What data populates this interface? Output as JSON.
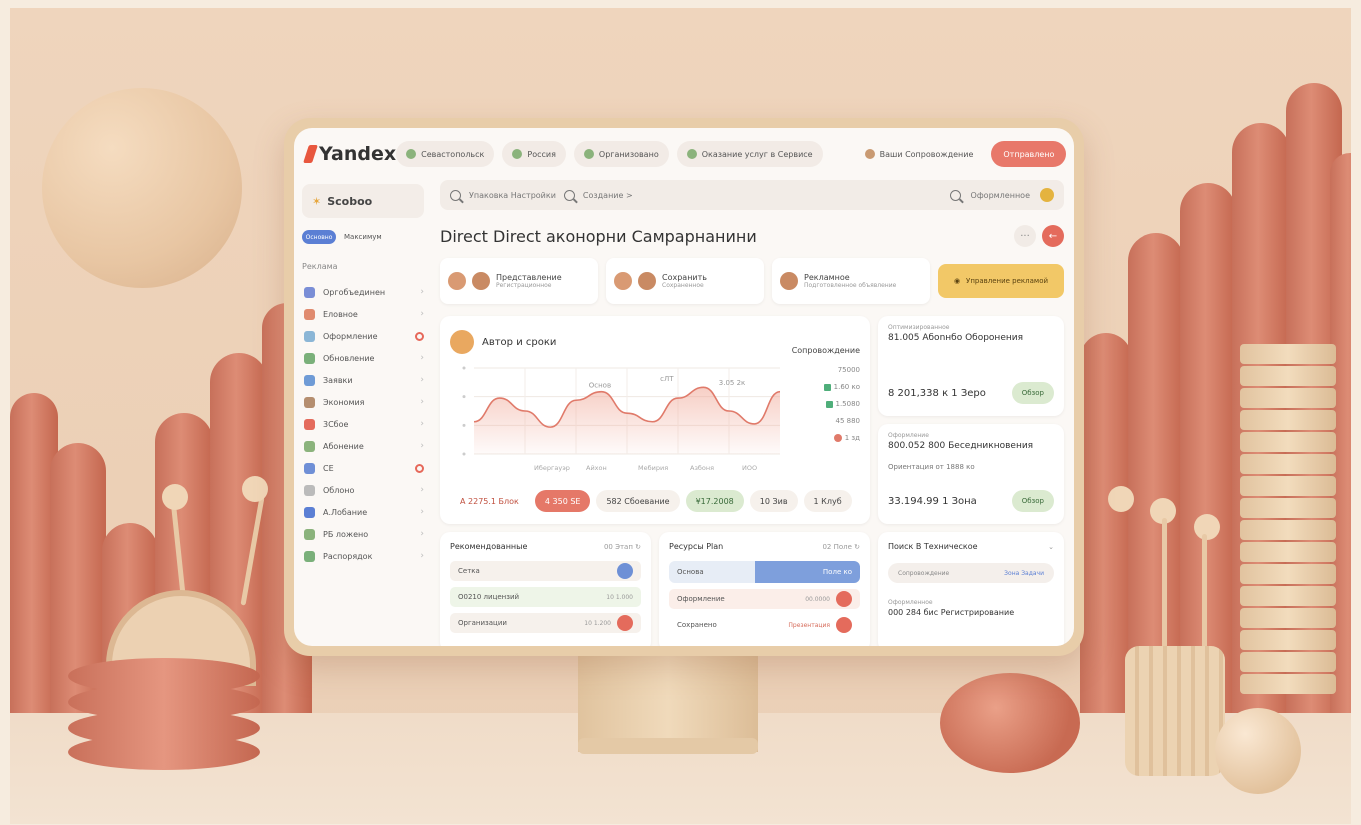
{
  "brand": {
    "name": "Yandex"
  },
  "nav": {
    "pills": [
      "Севастопольск",
      "Россия",
      "Организовано",
      "Оказание услуг в Сервисе"
    ],
    "secondary": "Ваши Сопровождение",
    "cta": "Отправлено"
  },
  "sidebar": {
    "head": "Scoboo",
    "toggle_label": "Основно",
    "toggle_text": "Максимум",
    "section": "Реклама",
    "items": [
      {
        "label": "Оргобъединен",
        "icon_color": "#7a8ed6"
      },
      {
        "label": "Еловное",
        "icon_color": "#e08b6f"
      },
      {
        "label": "Оформление",
        "icon_color": "#8bb6d6"
      },
      {
        "label": "Обновление",
        "icon_color": "#7ab07a"
      },
      {
        "label": "Заявки",
        "icon_color": "#6f9bd6"
      },
      {
        "label": "Экономия",
        "icon_color": "#b58e6f"
      },
      {
        "label": "3Сбое",
        "icon_color": "#e46b5c"
      },
      {
        "label": "Абонение",
        "icon_color": "#8bb37c"
      },
      {
        "label": "СЕ",
        "icon_color": "#6f8fd6"
      },
      {
        "label": "Облоно",
        "icon_color": "#bbbbbb"
      },
      {
        "label": "А.Лобание",
        "icon_color": "#5b7fd4"
      },
      {
        "label": "РБ ложено",
        "icon_color": "#8bb37c"
      },
      {
        "label": "Распорядок",
        "icon_color": "#7ab07a"
      }
    ]
  },
  "search": {
    "left": "Упаковка Настройки",
    "crumb": "Создание >",
    "right": "Оформленное"
  },
  "page": {
    "title": "Direct Direct аконоpни Самрарнанини"
  },
  "mini_cards": [
    {
      "title": "Представление",
      "sub": "Регистрационное"
    },
    {
      "title": "Сохранить",
      "sub": "Сохраненное"
    },
    {
      "title": "Рекламное",
      "sub": "Подготовленное объявление"
    }
  ],
  "mini_cta": "Управление рекламой",
  "chart_card": {
    "title": "Автор и сроки",
    "right_label": "Сопровождение",
    "legend": [
      "75000",
      "1.60 ко",
      "1.5080",
      "45 880",
      "1 зд"
    ],
    "annotations": [
      "Основ",
      "сЛТ",
      "3.05 2к"
    ],
    "xlabels": [
      "Ибергауэр",
      "Айхон",
      "Мебирия",
      "Азбоня",
      "ИОО"
    ],
    "chips": [
      "А 2275.1 Блок",
      "4 350 SE",
      "582 Сбоевание",
      "¥17.2008",
      "10 Зив",
      "1 Клуб"
    ]
  },
  "chart_data": {
    "type": "area",
    "x": [
      0,
      1,
      2,
      3,
      4,
      5,
      6,
      7,
      8,
      9,
      10,
      11,
      12
    ],
    "values": [
      30,
      52,
      40,
      25,
      50,
      58,
      38,
      30,
      52,
      62,
      40,
      28,
      58
    ],
    "grid": true
  },
  "stats": [
    {
      "small": "Оптимизированное",
      "bold": "81.005 Абоnнбо Оборонения",
      "big": "8 201,338 к 1 Зеро",
      "pill": "Обзор"
    },
    {
      "small": "Оформление",
      "bold": "800.052 800 Беседникновения",
      "sub": "Ориентация от 1888 ко",
      "big": "33.194.99 1 Зона",
      "pill": "Обзор"
    }
  ],
  "bottom": {
    "card1": {
      "title": "Рекомендованные",
      "right": "00 Этап ↻",
      "rows": [
        {
          "label": "Сетка",
          "value": ""
        },
        {
          "label": "О0210 лицензий",
          "value": "10 1.000"
        },
        {
          "label": "Организации",
          "value": "10 1.200"
        }
      ]
    },
    "card2": {
      "title": "Ресурсы Plan",
      "right": "02 Поле ↻",
      "tab_left": "Основа",
      "tab_right": "Поле ко",
      "rows": [
        {
          "label": "Оформление",
          "value": "00.0000"
        },
        {
          "label": "Сохранено",
          "value": "Презентация"
        }
      ]
    },
    "card3": {
      "title": "Поиск В Техническое",
      "seg_left": "Сопровождение",
      "seg_right": "Зона Задачи",
      "small": "Оформленное",
      "bold": "000 284 бис Регистрирование"
    }
  }
}
